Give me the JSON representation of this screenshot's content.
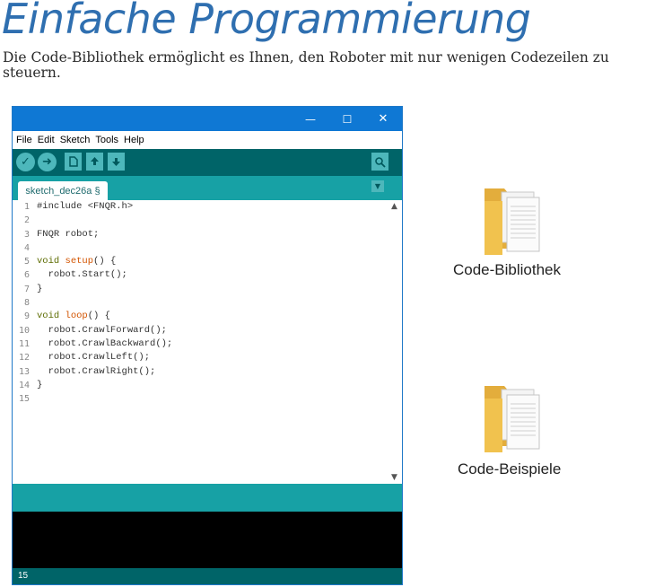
{
  "headline": "Einfache Programmierung",
  "subtitle": "Die Code-Bibliothek ermöglicht es Ihnen, den Roboter mit nur wenigen Codezeilen zu steuern.",
  "window": {
    "controls": {
      "minimize": "—",
      "maximize": "☐",
      "close": "✕"
    },
    "menu": [
      "File",
      "Edit",
      "Sketch",
      "Tools",
      "Help"
    ],
    "toolbar_icons": [
      "verify-icon",
      "upload-icon",
      "new-icon",
      "open-icon",
      "save-icon",
      "serial-monitor-icon"
    ],
    "tab_label": "sketch_dec26a §",
    "line_numbers": [
      "1",
      "2",
      "3",
      "4",
      "5",
      "6",
      "7",
      "8",
      "9",
      "10",
      "11",
      "12",
      "13",
      "14",
      "15"
    ],
    "code_lines": [
      "#include <FNQR.h>",
      "",
      "FNQR robot;",
      "",
      "void setup() {",
      "  robot.Start();",
      "}",
      "",
      "void loop() {",
      "  robot.CrawlForward();",
      "  robot.CrawlBackward();",
      "  robot.CrawlLeft();",
      "  robot.CrawlRight();",
      "}",
      ""
    ],
    "footer_text": "15"
  },
  "folders": [
    {
      "label": "Code-Bibliothek",
      "icon": "folder-icon"
    },
    {
      "label": "Code-Beispiele",
      "icon": "folder-icon"
    }
  ],
  "colors": {
    "headline": "#2f6fb0",
    "titlebar": "#0f78d4",
    "toolbar": "#006468",
    "tab_strip": "#17a1a5",
    "folder": "#f1c24e"
  }
}
